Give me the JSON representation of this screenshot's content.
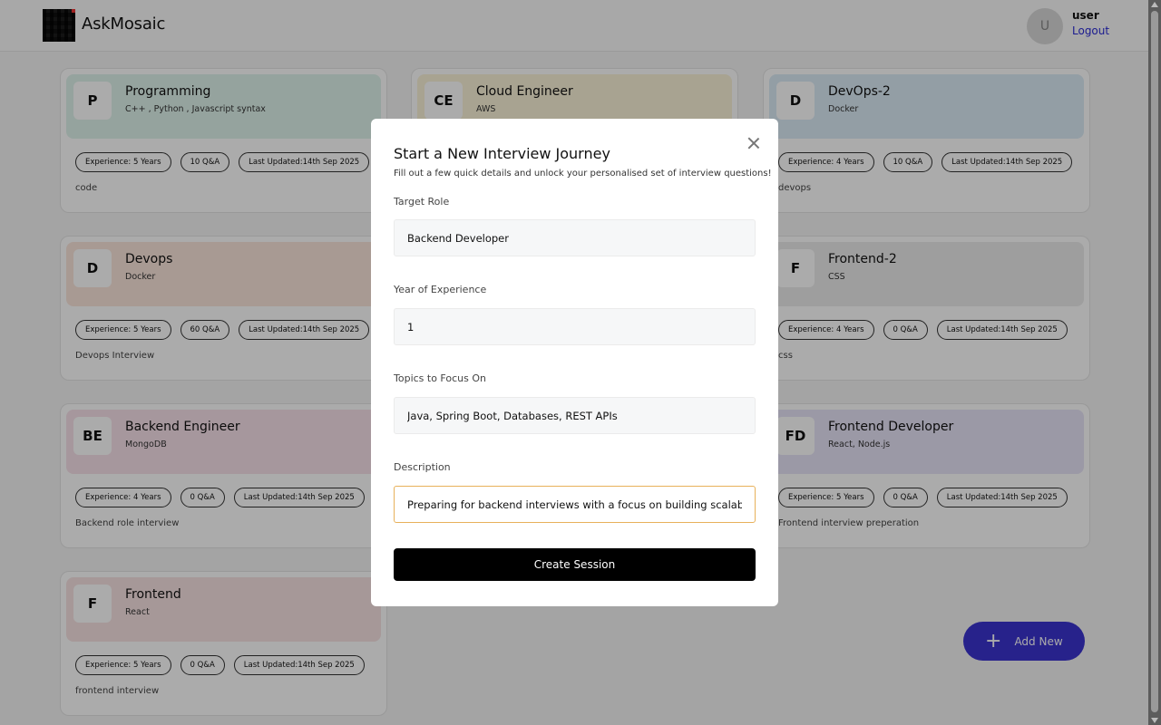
{
  "navbar": {
    "brand": "AskMosaic",
    "avatar_initial": "U",
    "username": "user",
    "logout": "Logout"
  },
  "cards": [
    {
      "initials": "P",
      "title": "Programming",
      "subtitle": "C++ , Python , Javascript syntax",
      "experience": "Experience: 5 Years",
      "qa": "10 Q&A",
      "updated": "Last Updated:14th Sep 2025",
      "description": "code",
      "color": "#dff3ec"
    },
    {
      "initials": "CE",
      "title": "Cloud Engineer",
      "subtitle": "AWS",
      "experience": "",
      "qa": "",
      "updated": "",
      "description": "",
      "color": "#fbf4d9"
    },
    {
      "initials": "D",
      "title": "DevOps-2",
      "subtitle": "Docker",
      "experience": "Experience: 4 Years",
      "qa": "10 Q&A",
      "updated": "Last Updated:14th Sep 2025",
      "description": "devops",
      "color": "#dcecf6"
    },
    {
      "initials": "D",
      "title": "Devops",
      "subtitle": "Docker",
      "experience": "Experience: 5 Years",
      "qa": "60 Q&A",
      "updated": "Last Updated:14th Sep 2025",
      "description": "Devops Interview",
      "color": "#fbe6dc"
    },
    {
      "initials": "F",
      "title": "Frontend-2",
      "subtitle": "CSS",
      "experience": "Experience: 4 Years",
      "qa": "0 Q&A",
      "updated": "Last Updated:14th Sep 2025",
      "description": "css",
      "color": "#ececec"
    },
    {
      "initials": "BE",
      "title": "Backend Engineer",
      "subtitle": "MongoDB",
      "experience": "Experience: 4 Years",
      "qa": "0 Q&A",
      "updated": "Last Updated:14th Sep 2025",
      "description": "Backend role interview",
      "color": "#f8e1ea"
    },
    {
      "initials": "FD",
      "title": "Frontend Developer",
      "subtitle": "React, Node.js",
      "experience": "Experience: 5 Years",
      "qa": "0 Q&A",
      "updated": "Last Updated:14th Sep 2025",
      "description": "Frontend interview preperation",
      "color": "#e8e4f8"
    },
    {
      "initials": "F",
      "title": "Frontend",
      "subtitle": "React",
      "experience": "Experience: 5 Years",
      "qa": "0 Q&A",
      "updated": "Last Updated:14th Sep 2025",
      "description": "frontend interview",
      "color": "#f8e3e3"
    }
  ],
  "add_new": {
    "label": "Add New",
    "icon": "plus-icon",
    "color": "#3b34d0"
  },
  "modal": {
    "title": "Start a New Interview Journey",
    "subtitle": "Fill out a few quick details and unlock your personalised set of interview questions!",
    "fields": {
      "role_label": "Target Role",
      "role_value": "Backend Developer",
      "experience_label": "Year of Experience",
      "experience_value": "1",
      "topics_label": "Topics to Focus On",
      "topics_value": "Java, Spring Boot, Databases, REST APIs",
      "description_label": "Description",
      "description_value": "Preparing for backend interviews with a focus on building scalable se"
    },
    "submit_label": "Create Session"
  }
}
